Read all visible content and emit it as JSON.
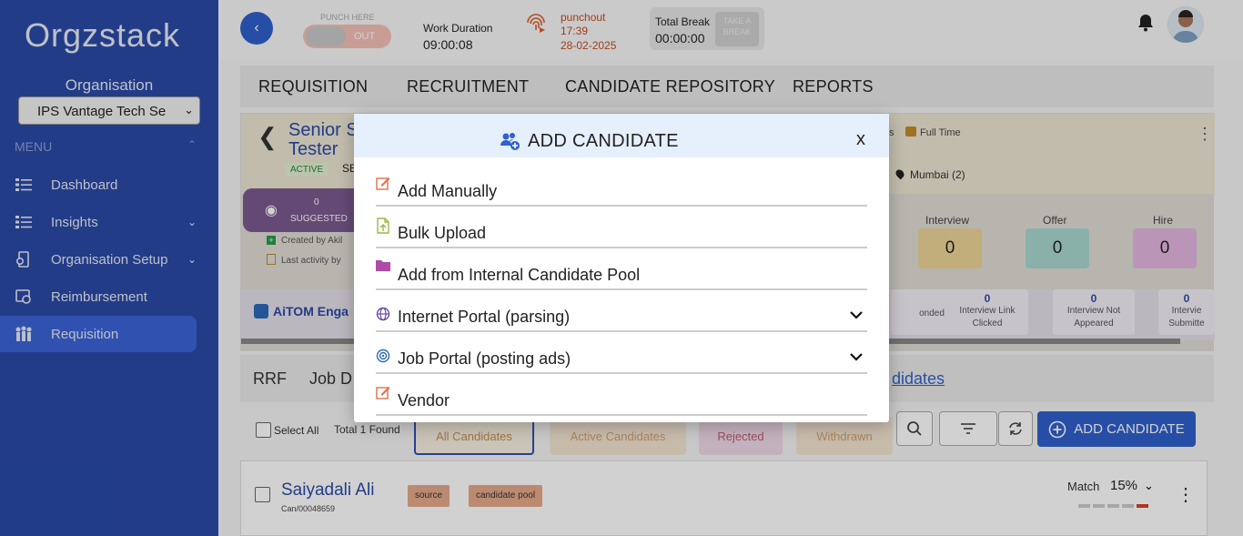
{
  "sidebar": {
    "logo": "Orgzstack",
    "org_label": "Organisation",
    "org_select": "IPS Vantage Tech Se",
    "menu_label": "MENU",
    "items": [
      {
        "label": "Dashboard",
        "icon": "dashboard-list-icon"
      },
      {
        "label": "Insights",
        "icon": "insights-list-icon"
      },
      {
        "label": "Organisation Setup",
        "icon": "org-setup-icon"
      },
      {
        "label": "Reimbursement",
        "icon": "reimbursement-icon"
      },
      {
        "label": "Requisition",
        "icon": "requisition-icon"
      }
    ]
  },
  "topbar": {
    "punch_here": "PUNCH HERE",
    "punch_state": "OUT",
    "work_duration_label": "Work Duration",
    "work_duration": "09:00:08",
    "punchout_label": "punchout",
    "punchout_time": "17:39",
    "punchout_date": "28-02-2025",
    "total_break_label": "Total Break",
    "total_break": "00:00:00",
    "take_break": "TAKE A BREAK"
  },
  "nav_tabs": [
    "REQUISITION",
    "RECRUITMENT",
    "CANDIDATE REPOSITORY",
    "REPORTS"
  ],
  "job": {
    "title_line1": "Senior S",
    "title_line2": "Tester",
    "status": "ACTIVE",
    "se": "SE",
    "employment_suffix": "s",
    "employment": "Full Time",
    "location": "Mumbai (2)",
    "suggested_count": "0",
    "suggested_label": "SUGGESTED",
    "created_by": "Created by Akil",
    "last_activity": "Last activity by",
    "stages": [
      {
        "label": "Interview",
        "value": "0",
        "color": "#ecd595"
      },
      {
        "label": "Offer",
        "value": "0",
        "color": "#a8d8d0"
      },
      {
        "label": "Hire",
        "value": "0",
        "color": "#e4b6e0"
      }
    ],
    "aitom": "AiTOM Enga",
    "stats": [
      {
        "value": "",
        "label": "onded"
      },
      {
        "value": "0",
        "label": "Interview Link Clicked"
      },
      {
        "value": "0",
        "label": "Interview Not Appeared"
      },
      {
        "value": "0",
        "label": "Intervie Submitte"
      }
    ]
  },
  "detail_tabs": {
    "rrf": "RRF",
    "jd": "Job D",
    "candidates": "didates"
  },
  "filters": {
    "select_all": "Select All",
    "total": "Total 1 Found",
    "chips": [
      "All Candidates",
      "Active Candidates",
      "Rejected",
      "Withdrawn"
    ],
    "add_candidate": "ADD CANDIDATE"
  },
  "candidate": {
    "name": "Saiyadali Ali",
    "id": "Can/00048659",
    "tags": [
      "source",
      "candidate pool"
    ],
    "match_label": "Match",
    "match_value": "15%"
  },
  "modal": {
    "title": "ADD CANDIDATE",
    "close": "x",
    "items": [
      {
        "label": "Add Manually",
        "icon": "edit-pencil-icon",
        "expandable": false
      },
      {
        "label": "Bulk Upload",
        "icon": "file-upload-icon",
        "expandable": false
      },
      {
        "label": "Add from Internal Candidate Pool",
        "icon": "folder-icon",
        "expandable": false
      },
      {
        "label": "Internet Portal (parsing)",
        "icon": "globe-icon",
        "expandable": true
      },
      {
        "label": "Job Portal (posting ads)",
        "icon": "target-icon",
        "expandable": true
      },
      {
        "label": "Vendor",
        "icon": "edit-pencil-icon",
        "expandable": false
      }
    ]
  },
  "colors": {
    "sidebar": "#2a4aa6",
    "active_nav": "#3b63d6",
    "accent": "#3060cc",
    "punchout": "#c64a21",
    "modal_header": "#e6effc"
  }
}
